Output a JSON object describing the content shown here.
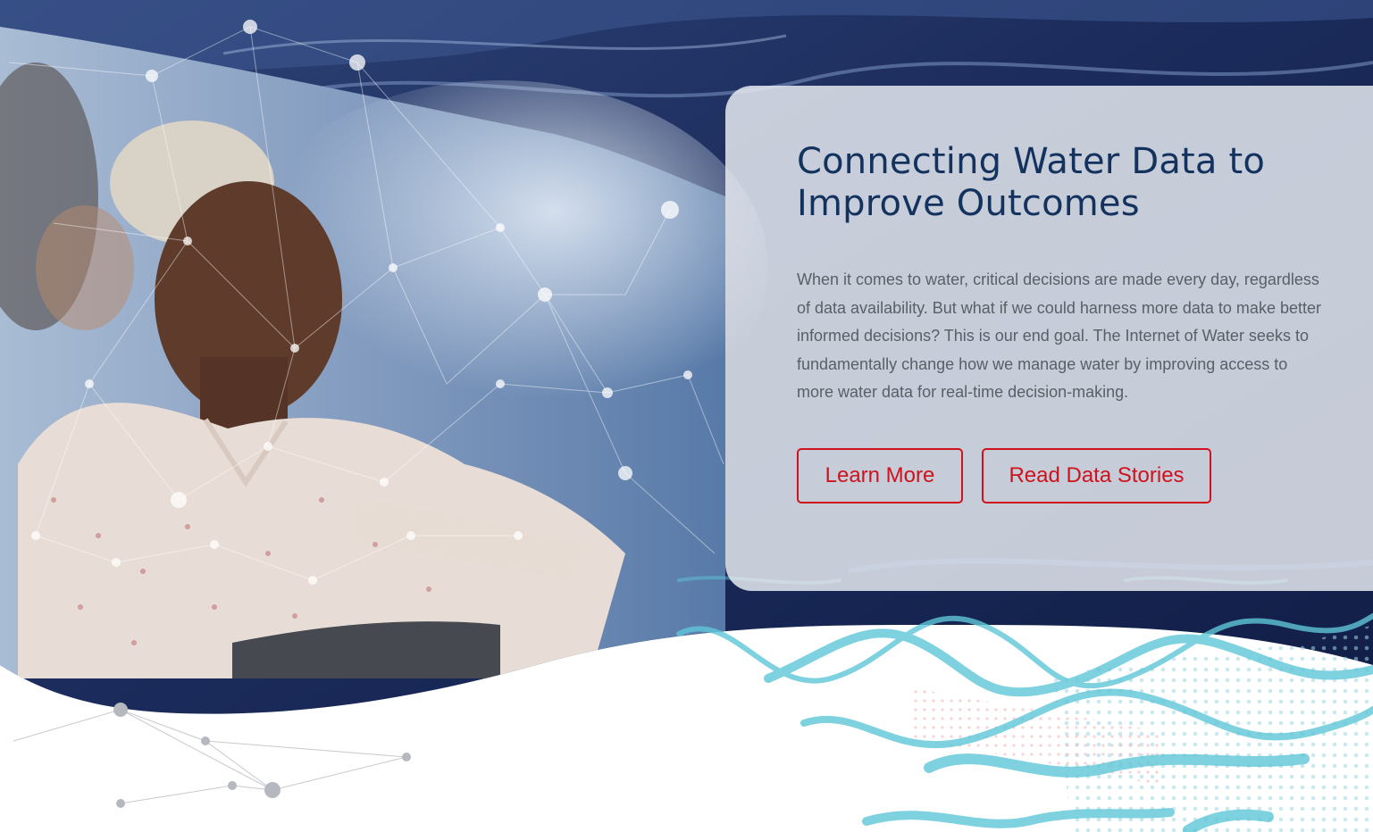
{
  "hero": {
    "title": "Connecting Water Data to Improve Outcomes",
    "description": "When it comes to water, critical decisions are made every day, regardless of data availability. But what if we could harness more data to make better informed decisions? This is our end goal. The Internet of Water seeks to fundamentally change how we manage water by improving access to more water data for real-time decision-making.",
    "buttons": {
      "learn_more": "Learn More",
      "read_data_stories": "Read Data Stories"
    }
  },
  "images": {
    "hero_photo": "person-at-computer-with-network-overlay",
    "water_texture": "flowing-water-background",
    "wave_decoration": "cyan-wave-pattern"
  },
  "colors": {
    "title": "#13325e",
    "body_text": "#5a5f66",
    "button_accent": "#d0121c",
    "wave_accent": "#5fc6d8",
    "water_dark": "#1a2a58"
  }
}
